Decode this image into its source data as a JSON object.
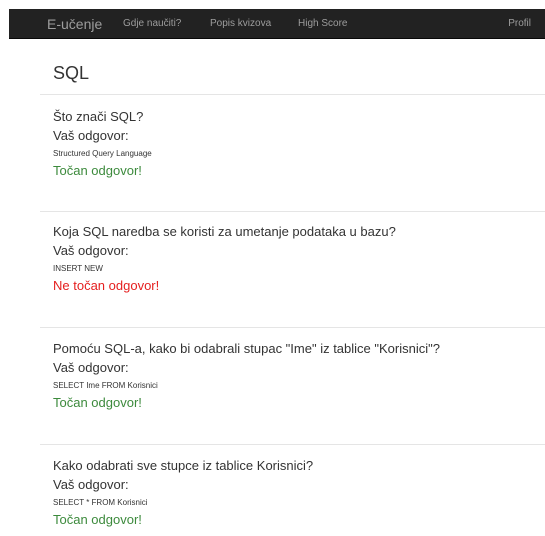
{
  "nav": {
    "brand": "E-učenje",
    "links": [
      "Gdje naučiti?",
      "Popis kvizova",
      "High Score"
    ],
    "right": "Profil"
  },
  "page": {
    "title": "SQL"
  },
  "colors": {
    "navbar_bg": "#222222",
    "nav_text": "#9d9d9d",
    "correct": "#3c8a3c",
    "wrong": "#e51f1f"
  },
  "questions": [
    {
      "question": "Što znači SQL?",
      "answer_label": "Vaš odgovor:",
      "answer": "Structured Query Language",
      "result": "Točan odgovor!",
      "correct": true
    },
    {
      "question": "Koja SQL naredba se koristi za umetanje podataka u bazu?",
      "answer_label": "Vaš odgovor:",
      "answer": "INSERT NEW",
      "result": "Ne točan odgovor!",
      "correct": false
    },
    {
      "question": "Pomoću SQL-a, kako bi odabrali stupac \"Ime\" iz tablice \"Korisnici\"?",
      "answer_label": "Vaš odgovor:",
      "answer": "SELECT Ime FROM Korisnici",
      "result": "Točan odgovor!",
      "correct": true
    },
    {
      "question": "Kako odabrati sve stupce iz tablice Korisnici?",
      "answer_label": "Vaš odgovor:",
      "answer": "SELECT * FROM Korisnici",
      "result": "Točan odgovor!",
      "correct": true
    }
  ]
}
